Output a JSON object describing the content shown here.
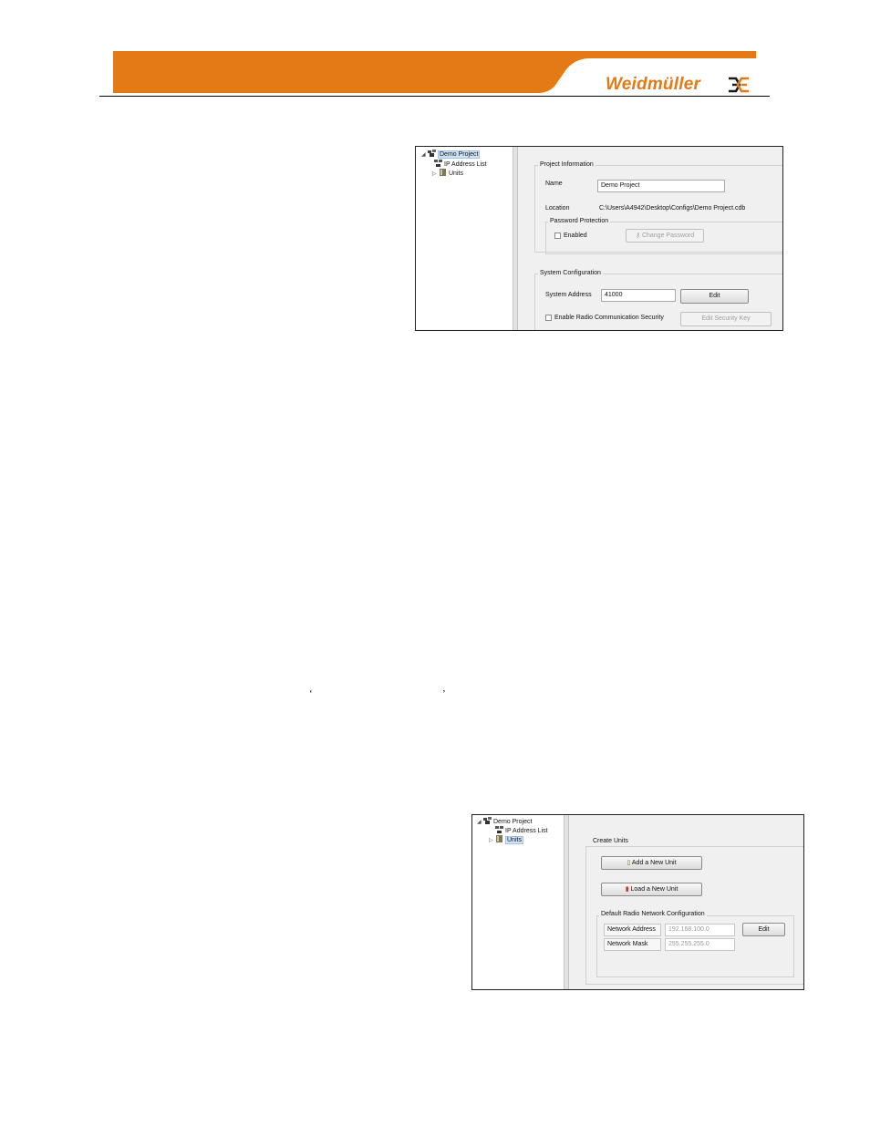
{
  "brand": {
    "logo_text": "Weidmüller",
    "color": "#e37a16"
  },
  "figure1": {
    "tree": {
      "root": "Demo Project",
      "items": [
        "IP Address List",
        "Units"
      ]
    },
    "project_information": {
      "title": "Project Information",
      "name_label": "Name",
      "name_value": "Demo Project",
      "location_label": "Location",
      "location_value": "C:\\Users\\A4942\\Desktop\\Configs\\Demo Project.cdb",
      "password_protection": {
        "title": "Password Protection",
        "enabled_label": "Enabled",
        "change_password_label": "Change Password"
      }
    },
    "system_configuration": {
      "title": "System Configuration",
      "address_label": "System Address",
      "address_value": "41000",
      "edit_label": "Edit",
      "security_label": "Enable Radio Communication Security",
      "edit_security_key_label": "Edit Security Key"
    }
  },
  "quotes": {
    "open": "‘",
    "close": "’"
  },
  "figure2": {
    "tree": {
      "root": "Demo Project",
      "items": [
        "IP Address List",
        "Units"
      ]
    },
    "create_units": {
      "title": "Create Units",
      "add_label": "Add a New Unit",
      "load_label": "Load a New Unit"
    },
    "default_network": {
      "title": "Default Radio Network Configuration",
      "address_label": "Network Address",
      "address_value": "192.168.100.0",
      "mask_label": "Network Mask",
      "mask_value": "255.255.255.0",
      "edit_label": "Edit"
    }
  }
}
